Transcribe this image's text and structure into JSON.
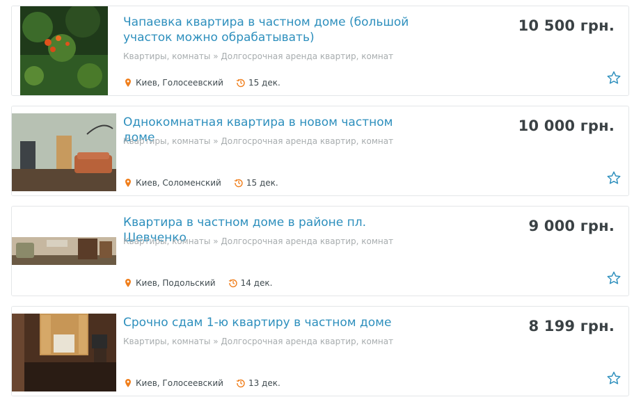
{
  "listings": [
    {
      "title": "Чапаевка квартира в частном доме (большой участок можно обрабатывать)",
      "category": "Квартиры, комнаты » Долгосрочная аренда квартир, комнат",
      "location": "Киев, Голосеевский",
      "date": "15 дек.",
      "price": "10 500 грн."
    },
    {
      "title": "Однокомнатная квартира в новом частном доме",
      "category": "Квартиры, комнаты » Долгосрочная аренда квартир, комнат",
      "location": "Киев, Соломенский",
      "date": "15 дек.",
      "price": "10 000 грн."
    },
    {
      "title": "Квартира в частном доме в районе пл. Шевченко",
      "category": "Квартиры, комнаты » Долгосрочная аренда квартир, комнат",
      "location": "Киев, Подольский",
      "date": "14 дек.",
      "price": "9 000 грн."
    },
    {
      "title": "Срочно сдам 1-ю квартиру в частном доме",
      "category": "Квартиры, комнаты » Долгосрочная аренда квартир, комнат",
      "location": "Киев, Голосеевский",
      "date": "13 дек.",
      "price": "8 199 грн."
    }
  ],
  "icons": {
    "location": "map-pin-icon",
    "date": "clock-history-icon",
    "favorite": "star-outline-icon"
  },
  "colors": {
    "title": "#2d8fbd",
    "category": "#a7acae",
    "price": "#3a4144",
    "pin": "#f07e1b",
    "star": "#2d8fbd"
  }
}
